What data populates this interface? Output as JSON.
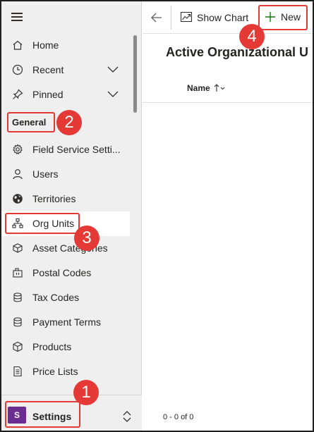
{
  "sidebar": {
    "items": [
      {
        "label": "Home",
        "icon": "home-icon"
      },
      {
        "label": "Recent",
        "icon": "clock-icon",
        "expandable": true
      },
      {
        "label": "Pinned",
        "icon": "pin-icon",
        "expandable": true
      }
    ],
    "section_header": "General",
    "general_items": [
      {
        "label": "Field Service Setti...",
        "icon": "gear-icon"
      },
      {
        "label": "Users",
        "icon": "person-icon"
      },
      {
        "label": "Territories",
        "icon": "globe-icon"
      },
      {
        "label": "Org Units",
        "icon": "org-chart-icon",
        "selected": true
      },
      {
        "label": "Asset Categories",
        "icon": "asset-category-icon"
      },
      {
        "label": "Postal Codes",
        "icon": "postal-code-icon"
      },
      {
        "label": "Tax Codes",
        "icon": "stack-icon"
      },
      {
        "label": "Payment Terms",
        "icon": "stack-icon"
      },
      {
        "label": "Products",
        "icon": "box-icon"
      },
      {
        "label": "Price Lists",
        "icon": "document-icon"
      }
    ],
    "area": {
      "avatar_letter": "S",
      "label": "Settings"
    }
  },
  "toolbar": {
    "show_chart_label": "Show Chart",
    "new_label": "New"
  },
  "main": {
    "view_title": "Active Organizational U",
    "column_name": "Name",
    "record_count": "0 - 0 of 0"
  },
  "annotations": {
    "badge1": "1",
    "badge2": "2",
    "badge3": "3",
    "badge4": "4"
  },
  "colors": {
    "accent_red": "#e53935",
    "area_purple": "#6b2d8f",
    "new_plus_green": "#107c10"
  }
}
